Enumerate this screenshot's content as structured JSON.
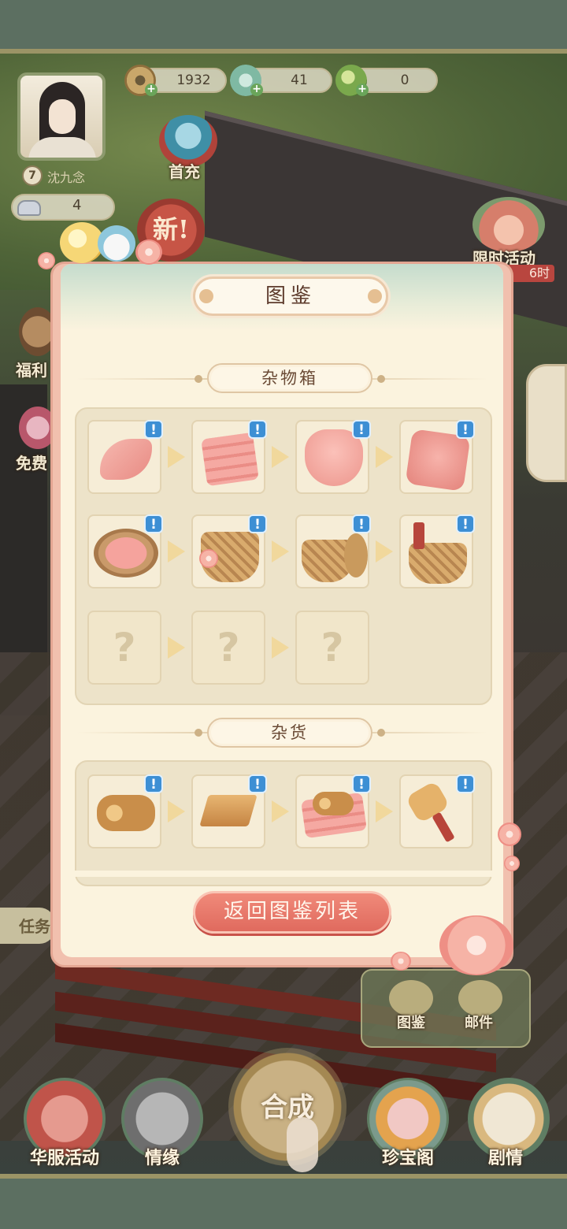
{
  "header": {
    "currency": [
      {
        "icon": "copper-coin-icon",
        "value": "1932"
      },
      {
        "icon": "jade-bead-icon",
        "value": "41"
      },
      {
        "icon": "green-bird-icon",
        "value": "0"
      }
    ]
  },
  "player": {
    "level": "7",
    "name": "沈九念",
    "silver": "4"
  },
  "side_buttons": {
    "first_charge": "首充",
    "new_badge": "新!",
    "limited_event": "限时活动",
    "limited_timer": "6时",
    "welfare": "福利",
    "free": "免费",
    "task": "任务",
    "codex": "图鉴",
    "mail": "邮件"
  },
  "bottom_nav": {
    "fashion_event": "华服活动",
    "bond": "情缘",
    "merge": "合成",
    "treasure": "珍宝阁",
    "story": "剧情"
  },
  "modal": {
    "title": "图鉴",
    "back_label": "返回图鉴列表",
    "sections": [
      {
        "name": "杂物箱",
        "items": [
          {
            "icon": "pink-scarf-icon",
            "unlocked": true,
            "new": true
          },
          {
            "icon": "folded-cloth-icon",
            "unlocked": true,
            "new": true
          },
          {
            "icon": "cloth-bag-icon",
            "unlocked": true,
            "new": true
          },
          {
            "icon": "cloth-bundle-icon",
            "unlocked": true,
            "new": true
          },
          {
            "icon": "cloth-sieve-icon",
            "unlocked": true,
            "new": true
          },
          {
            "icon": "flower-basket-icon",
            "unlocked": true,
            "new": true
          },
          {
            "icon": "lidded-basket-icon",
            "unlocked": true,
            "new": true
          },
          {
            "icon": "tool-bucket-icon",
            "unlocked": true,
            "new": true
          },
          {
            "icon": "unknown-icon",
            "unlocked": false,
            "label": "?"
          },
          {
            "icon": "unknown-icon",
            "unlocked": false,
            "label": "?"
          },
          {
            "icon": "unknown-icon",
            "unlocked": false,
            "label": "?"
          }
        ]
      },
      {
        "name": "杂货",
        "items": [
          {
            "icon": "wood-logs-icon",
            "unlocked": true,
            "new": true
          },
          {
            "icon": "wood-planks-icon",
            "unlocked": true,
            "new": true
          },
          {
            "icon": "wood-on-cloth-icon",
            "unlocked": true,
            "new": true
          },
          {
            "icon": "wooden-mallet-icon",
            "unlocked": true,
            "new": true
          }
        ]
      }
    ],
    "badge_text": "!"
  }
}
